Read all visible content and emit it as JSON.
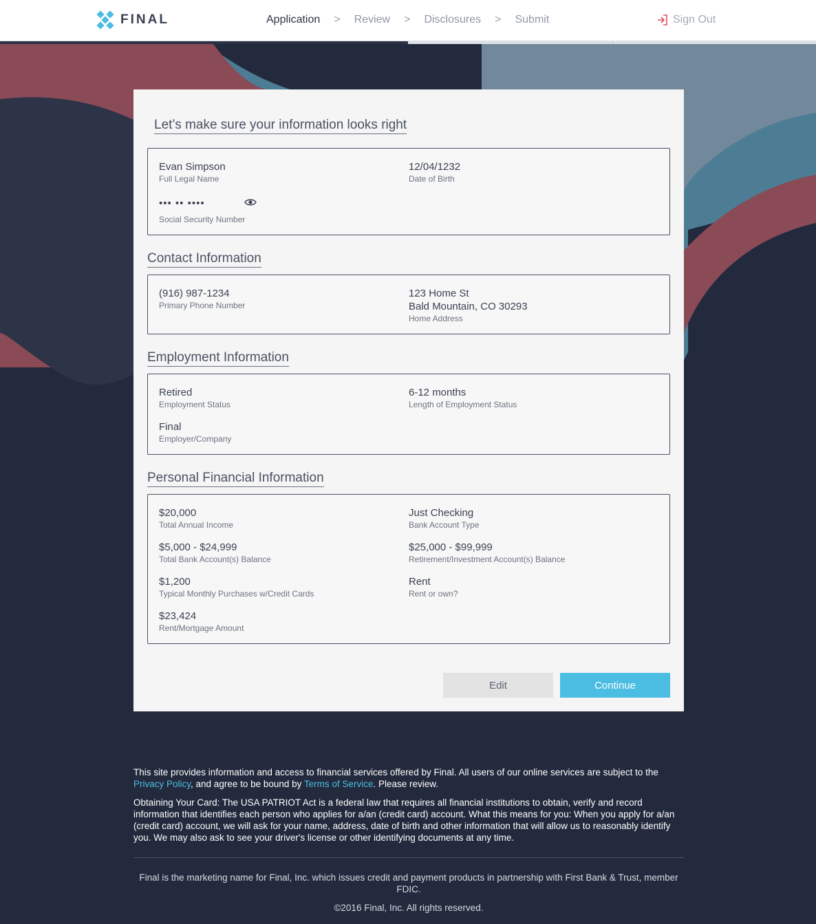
{
  "header": {
    "logo_text": "FINAL",
    "steps": [
      {
        "label": "Application",
        "active": true
      },
      {
        "label": "Review",
        "active": false
      },
      {
        "label": "Disclosures",
        "active": false
      },
      {
        "label": "Submit",
        "active": false
      }
    ],
    "step_separator": ">",
    "sign_out_label": "Sign Out"
  },
  "colors": {
    "accent": "#4bbde3",
    "dark_navy": "#232a3d",
    "rose": "#8a4b57",
    "slate_blue": "#4c7d95",
    "steel": "#71899b"
  },
  "card": {
    "title": "Let’s make sure your information looks right",
    "identity": {
      "full_name": {
        "value": "Evan Simpson",
        "label": "Full Legal Name"
      },
      "dob": {
        "value": "12/04/1232",
        "label": "Date of Birth"
      },
      "ssn": {
        "value": "••• •• ••••",
        "label": "Social Security Number",
        "reveal_icon": "eye-icon"
      }
    },
    "contact": {
      "title": "Contact Information",
      "phone": {
        "value": "(916) 987-1234",
        "label": "Primary Phone Number"
      },
      "address": {
        "line1": "123 Home St",
        "line2": "Bald Mountain, CO 30293",
        "label": "Home Address"
      }
    },
    "employment": {
      "title": "Employment Information",
      "status": {
        "value": "Retired",
        "label": "Employment Status"
      },
      "length": {
        "value": "6-12 months",
        "label": "Length of Employment Status"
      },
      "employer": {
        "value": "Final",
        "label": "Employer/Company"
      }
    },
    "financial": {
      "title": "Personal Financial Information",
      "income": {
        "value": "$20,000",
        "label": "Total Annual Income"
      },
      "account_type": {
        "value": "Just Checking",
        "label": "Bank Account Type"
      },
      "bank_balance": {
        "value": "$5,000 - $24,999",
        "label": "Total Bank Account(s) Balance"
      },
      "retirement_balance": {
        "value": "$25,000 - $99,999",
        "label": "Retirement/Investment Account(s) Balance"
      },
      "monthly_purchases": {
        "value": "$1,200",
        "label": "Typical Monthly Purchases w/Credit Cards"
      },
      "rent_or_own": {
        "value": "Rent",
        "label": "Rent or own?"
      },
      "rent_amount": {
        "value": "$23,424",
        "label": "Rent/Mortgage Amount"
      }
    },
    "buttons": {
      "edit": "Edit",
      "continue": "Continue"
    }
  },
  "footer": {
    "p1_start": "This site provides information and access to financial services offered by Final. All users of our online services are subject to the ",
    "privacy_link": "Privacy Policy",
    "p1_mid": ", and agree to be bound by ",
    "terms_link": "Terms of Service",
    "p1_end": ". Please review.",
    "p2": "Obtaining Your Card: The USA PATRIOT Act is a federal law that requires all financial institutions to obtain, verify and record information that identifies each person who applies for a/an (credit card) account. What this means for you: When you apply for a/an (credit card) account, we will ask for your name, address, date of birth and other information that will allow us to reasonably identify you. We may also ask to see your driver's license or other identifying documents at any time.",
    "marketing": "Final is the marketing name for Final, Inc. which issues credit and payment products in partnership with First Bank & Trust, member FDIC.",
    "copyright": "©2016 Final, Inc. All rights reserved."
  }
}
